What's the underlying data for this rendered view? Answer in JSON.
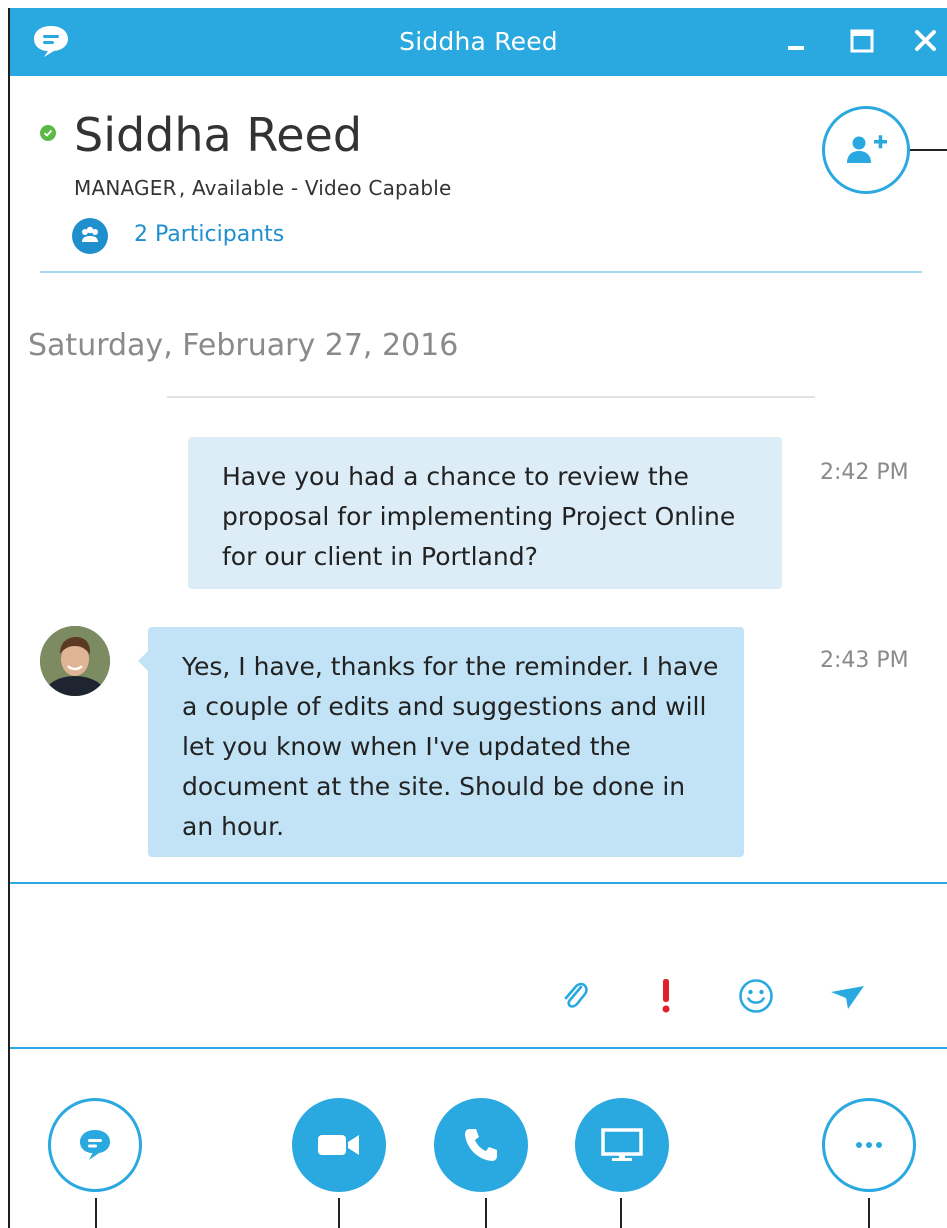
{
  "window": {
    "title": "Siddha Reed"
  },
  "header": {
    "name": "Siddha Reed",
    "status": "MANAGER , Available - Video Capable",
    "participants": "2 Participants"
  },
  "conversation": {
    "date": "Saturday, February 27, 2016",
    "messages": [
      {
        "text": "Have you had a chance to review the proposal for implementing Project Online for our client in Portland?",
        "time": "2:42 PM"
      },
      {
        "text": "Yes, I have, thanks for the reminder. I have a couple of edits and suggestions and will let you know when I've updated the document at the site. Should be done in an hour.",
        "time": "2:43 PM"
      }
    ]
  },
  "compose": {
    "placeholder": "",
    "tools": [
      "paperclip-icon",
      "exclamation-icon",
      "smiley-icon",
      "send-icon"
    ]
  },
  "bottom_bar": [
    "chat-icon",
    "video-camera-icon",
    "phone-icon",
    "monitor-icon",
    "more-icon"
  ],
  "colors": {
    "accent": "#2aa8e0",
    "presence_available": "#5cb947",
    "bubble_sent": "#dcedf7",
    "bubble_received": "#c2e3f5",
    "important": "#e0202a"
  }
}
